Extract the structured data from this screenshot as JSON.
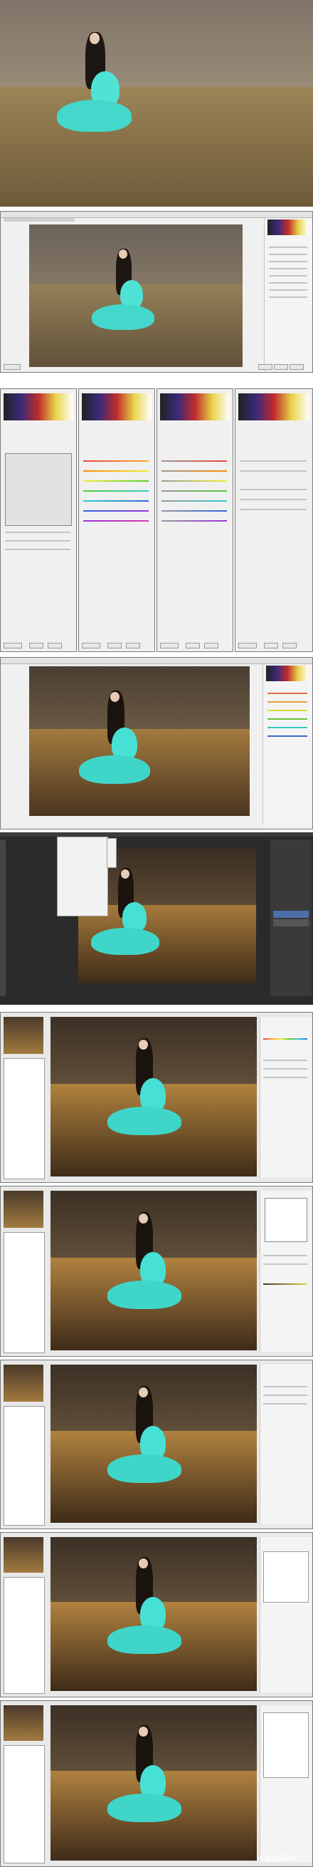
{
  "watermark": "@ 图虫摄影网",
  "panel_count": 10,
  "colors": {
    "dress": "#3fd6c9",
    "grass": "#a8864e",
    "sky": "#6a625a",
    "window_bg": "#f0f0f0",
    "dark_ps": "#2b2b2b"
  },
  "panels": [
    {
      "name": "original-photo"
    },
    {
      "name": "camera-raw-window-1"
    },
    {
      "name": "camera-raw-hsl-tabs"
    },
    {
      "name": "camera-raw-window-2"
    },
    {
      "name": "photoshop-image-menu"
    },
    {
      "name": "color-efex-window-1"
    },
    {
      "name": "color-efex-window-2"
    },
    {
      "name": "color-efex-window-3"
    },
    {
      "name": "color-efex-window-4"
    },
    {
      "name": "color-efex-window-5"
    }
  ]
}
